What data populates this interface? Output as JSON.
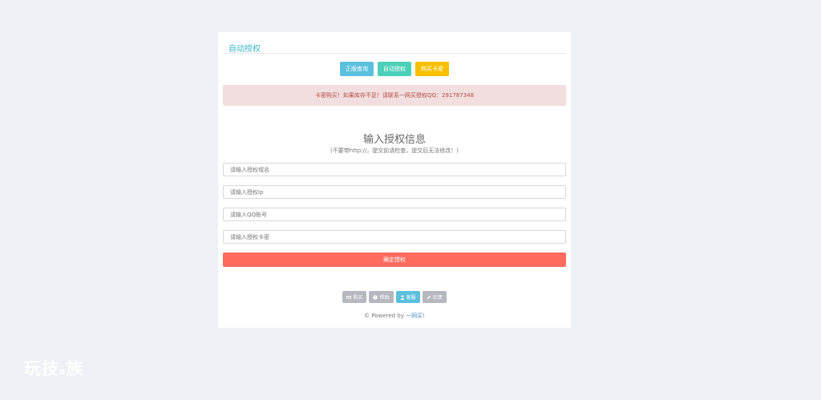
{
  "panel": {
    "title": "自动授权"
  },
  "top_buttons": {
    "genuine_query": "正版查询",
    "auto_auth": "自动授权",
    "buy_card": "购买卡密"
  },
  "alert": {
    "text": "卡密购买！如果库存不足！请联系一网买授权QQ：291787348"
  },
  "form": {
    "heading": "输入授权信息",
    "subtitle": "(不要带http://，提交前请检查，提交后无法修改！)",
    "domain_placeholder": "请输入授权域名",
    "ip_placeholder": "请输入授权ip",
    "qq_placeholder": "请输入QQ账号",
    "card_placeholder": "请输入授权卡密",
    "submit_label": "确定授权"
  },
  "bottom_buttons": {
    "buy": "购买",
    "help": "帮助",
    "service": "客服",
    "feedback": "反馈"
  },
  "footer": {
    "prefix": "© Powered by ",
    "brand": "一网买!"
  },
  "watermark": {
    "part1": "玩技",
    "part2": "e",
    "part3": "族"
  },
  "colors": {
    "accent": "#3bb4c8",
    "info": "#5bc0de",
    "teal": "#4ccfb8",
    "warning": "#f6c000",
    "danger": "#ff6b5e",
    "alert_bg": "#f2dede"
  },
  "icons": {
    "buy": "card-icon",
    "help": "question-circle-icon",
    "service": "user-icon",
    "feedback": "pencil-icon"
  }
}
